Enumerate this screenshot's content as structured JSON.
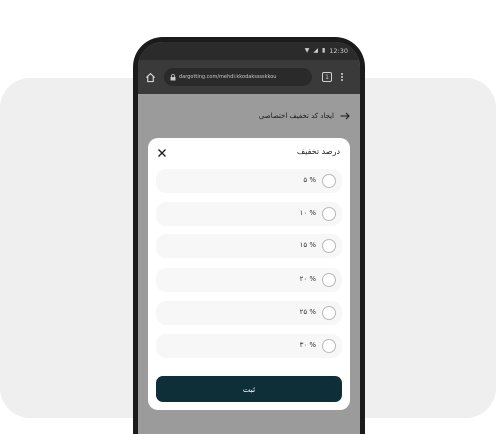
{
  "status": {
    "time": "12:30"
  },
  "browser": {
    "url": "dargotting.com/mehdi:kkodaksssskkou",
    "tab_count": "1"
  },
  "page": {
    "title": "ایجاد کد تخفیف اختصاصی"
  },
  "sheet": {
    "title": "درصد تخفیف",
    "options": [
      {
        "label": "% ۵"
      },
      {
        "label": "% ۱۰"
      },
      {
        "label": "% ۱۵"
      },
      {
        "label": "% ۲۰"
      },
      {
        "label": "% ۲۵"
      },
      {
        "label": "% ۳۰"
      }
    ],
    "submit_label": "ثبت"
  },
  "colors": {
    "accent": "#0f2f38",
    "overlay": "#9b9b9b"
  }
}
